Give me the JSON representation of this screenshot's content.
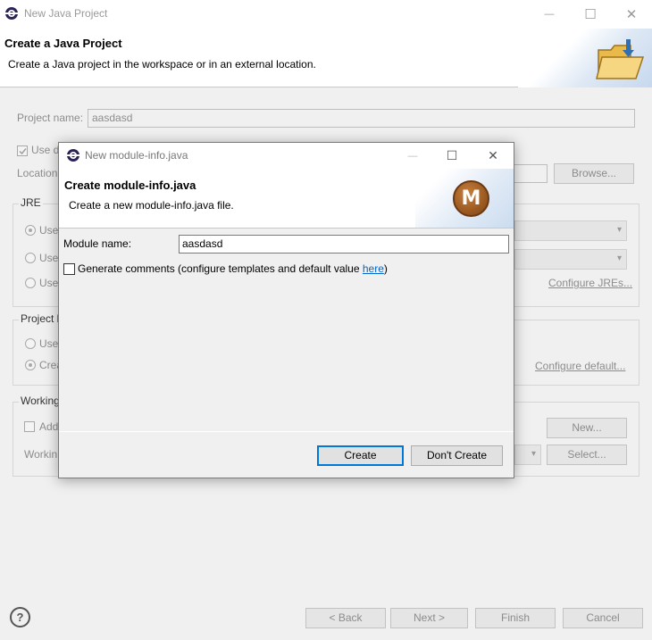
{
  "main": {
    "title": "New Java Project",
    "header_title": "Create a Java Project",
    "header_desc": "Create a Java project in the workspace or in an external location.",
    "project_name_label": "Project name:",
    "project_name_value": "aasdasd",
    "use_default_label": "Use d",
    "location_label": "Location",
    "browse_label": "Browse...",
    "jre_group": "JRE",
    "jre_options": [
      "Use",
      "Use",
      "Use"
    ],
    "configure_jres": "Configure JREs...",
    "layout_group": "Project l",
    "layout_options": [
      "Use",
      "Crea"
    ],
    "configure_default": "Configure default...",
    "working_group": "Working",
    "add_label": "Add",
    "working_sets_label": "Workin",
    "new_label": "New...",
    "select_label": "Select...",
    "back_label": "< Back",
    "next_label": "Next >",
    "finish_label": "Finish",
    "cancel_label": "Cancel",
    "help_icon": "question-icon"
  },
  "dialog": {
    "title": "New module-info.java",
    "header_title": "Create module-info.java",
    "header_desc": "Create a new module-info.java file.",
    "badge": "M",
    "module_name_label": "Module name:",
    "module_name_value": "aasdasd",
    "generate_comments_label": "Generate comments",
    "generate_comments_suffix_open": " (configure templates and default value ",
    "generate_comments_link": "here",
    "generate_comments_suffix_close": ")",
    "generate_comments_checked": false,
    "create_label": "Create",
    "dont_create_label": "Don't Create"
  },
  "window_controls": {
    "minimize": "—",
    "maximize": "☐",
    "close": "✕"
  }
}
